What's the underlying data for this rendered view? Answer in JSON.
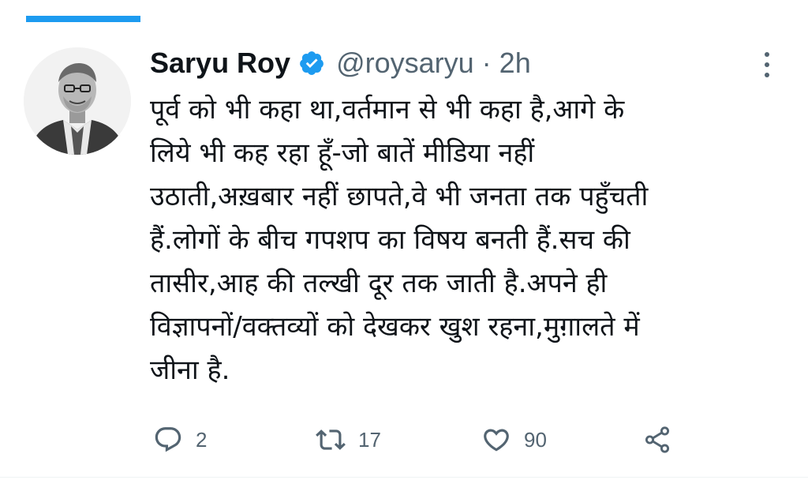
{
  "tweet": {
    "author": {
      "display_name": "Saryu Roy",
      "handle": "@roysaryu",
      "verified": true
    },
    "separator": "·",
    "time": "2h",
    "lines": [
      "पूर्व को भी कहा था,वर्तमान से भी कहा है,आगे के",
      "लिये भी कह रहा हूँ-जो बातें मीडिया नहीं",
      "उठाती,अख़बार नहीं छापते,वे भी जनता तक पहुँचती",
      "हैं.लोगों के बीच गपशप का विषय बनती हैं.सच की",
      "तासीर,आह की तल्खी दूर तक जाती है.अपने ही",
      "विज्ञापनों/वक्तव्यों को देखकर खुश रहना,मुग़ालते में",
      "जीना है."
    ],
    "actions": {
      "reply_count": "2",
      "retweet_count": "17",
      "like_count": "90"
    }
  },
  "icons": {
    "verified": "verified-badge-icon",
    "more": "more-options-icon",
    "reply": "reply-icon",
    "retweet": "retweet-icon",
    "like": "heart-icon",
    "share": "share-icon"
  },
  "colors": {
    "accent": "#1d9bf0",
    "text": "#0f1419",
    "secondary": "#536471"
  }
}
